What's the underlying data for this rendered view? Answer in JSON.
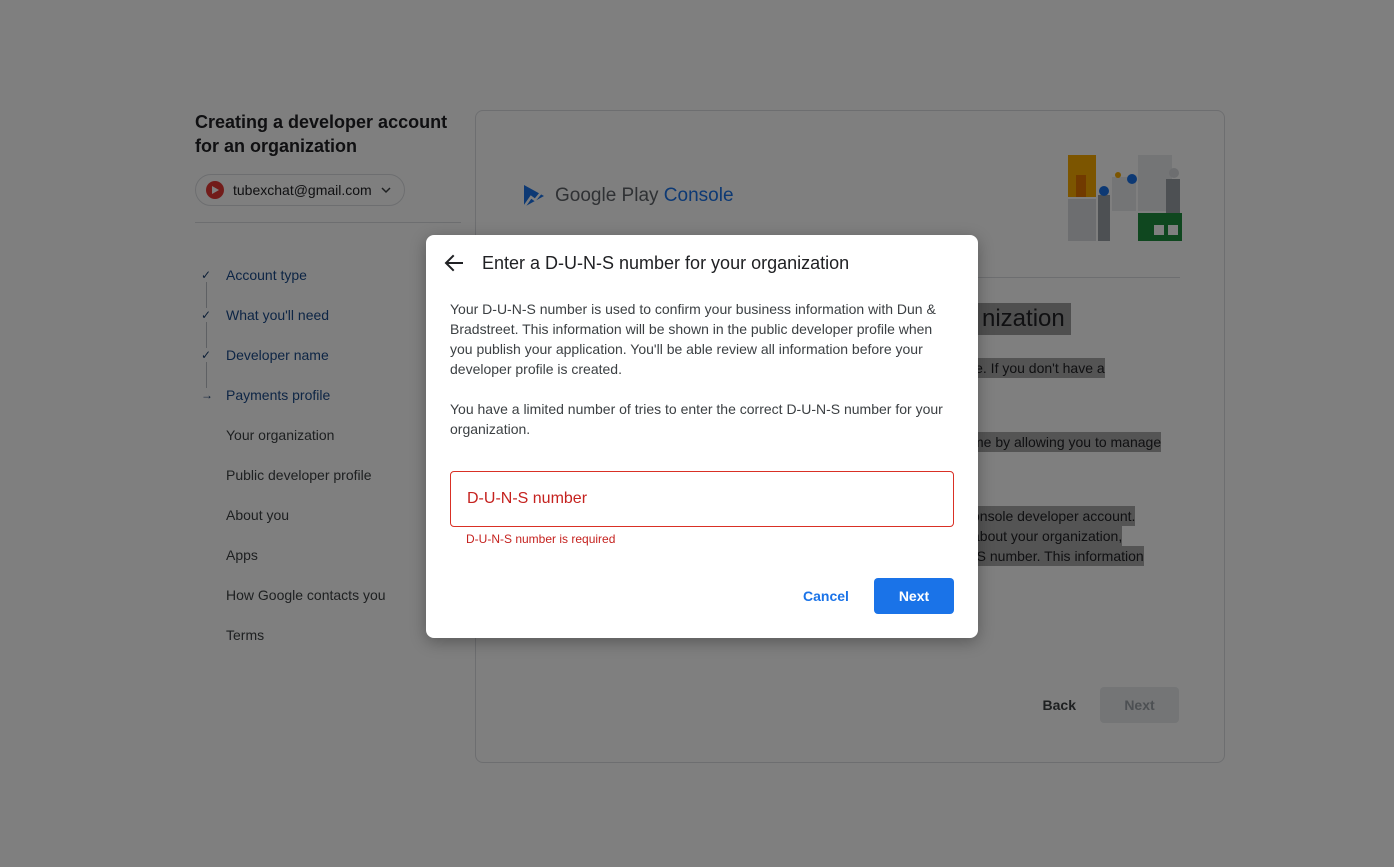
{
  "sidebar": {
    "title": "Creating a developer account for an organization",
    "account_email": "tubexchat@gmail.com",
    "steps": [
      {
        "label": "Account type",
        "status": "done",
        "mark": "✓"
      },
      {
        "label": "What you'll need",
        "status": "done",
        "mark": "✓"
      },
      {
        "label": "Developer name",
        "status": "done",
        "mark": "✓"
      },
      {
        "label": "Payments profile",
        "status": "current",
        "mark": "→"
      },
      {
        "label": "Your organization",
        "status": "pending",
        "mark": ""
      },
      {
        "label": "Public developer profile",
        "status": "pending",
        "mark": ""
      },
      {
        "label": "About you",
        "status": "pending",
        "mark": ""
      },
      {
        "label": "Apps",
        "status": "pending",
        "mark": ""
      },
      {
        "label": "How Google contacts you",
        "status": "pending",
        "mark": ""
      },
      {
        "label": "Terms",
        "status": "pending",
        "mark": ""
      }
    ]
  },
  "main": {
    "logo_text_1": "Google Play",
    "logo_text_2": "Console",
    "heading_partial": "nization",
    "text_fragments": [
      "le. If you don't have a",
      "me by allowing you to manage",
      "onsole developer account.",
      "about your organization,",
      "-S number. This information"
    ],
    "back_label": "Back",
    "next_label": "Next"
  },
  "dialog": {
    "title": "Enter a D-U-N-S number for your organization",
    "paragraph_1": "Your D-U-N-S number is used to confirm your business information with Dun & Bradstreet. This information will be shown in the public developer profile when you publish your application. You'll be able review all information before your developer profile is created.",
    "paragraph_2": "You have a limited number of tries to enter the correct D-U-N-S number for your organization.",
    "input_placeholder": "D-U-N-S number",
    "input_value": "",
    "error_text": "D-U-N-S number is required",
    "cancel_label": "Cancel",
    "next_label": "Next"
  },
  "colors": {
    "accent": "#1a73e8",
    "error": "#c5221f",
    "scrim": "rgba(0,0,0,0.5)"
  }
}
